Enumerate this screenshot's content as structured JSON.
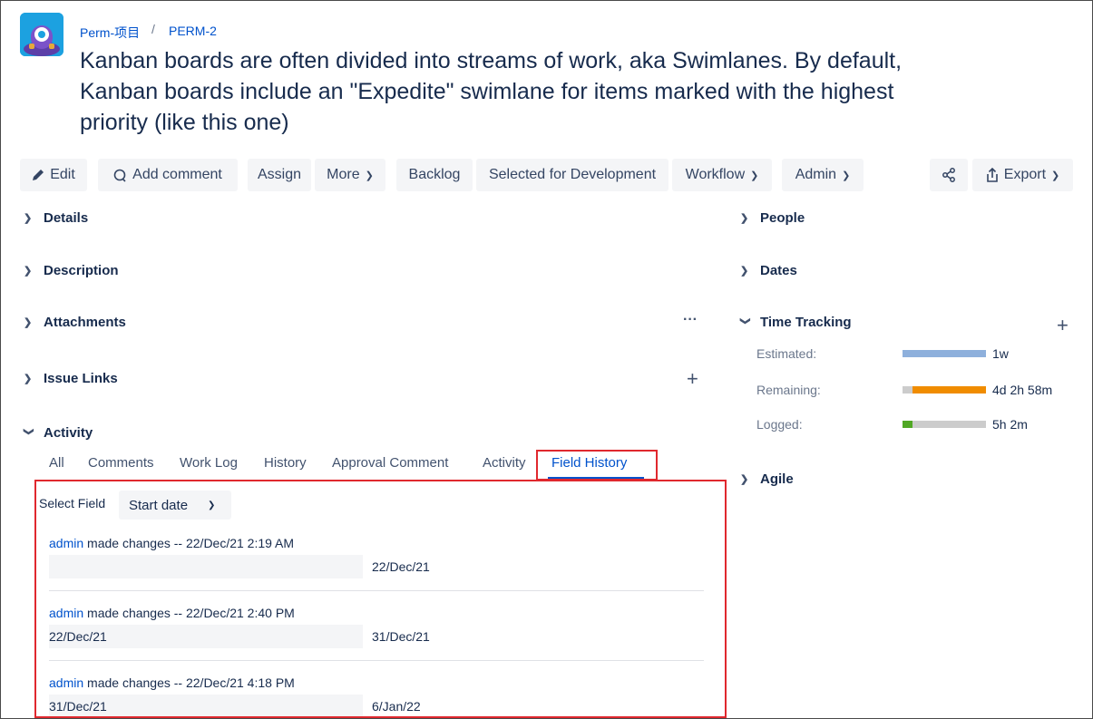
{
  "breadcrumb": {
    "project": "Perm-项目",
    "separator": "/",
    "issue_key": "PERM-2"
  },
  "summary": "Kanban boards are often divided into streams of work, aka Swimlanes. By default, Kanban boards include an \"Expedite\" swimlane for items marked with the highest priority (like this one)",
  "toolbar": {
    "edit": "Edit",
    "add_comment": "Add comment",
    "assign": "Assign",
    "more": "More",
    "backlog": "Backlog",
    "selected_for_development": "Selected for Development",
    "workflow": "Workflow",
    "admin": "Admin",
    "export": "Export"
  },
  "sections": {
    "details": "Details",
    "description": "Description",
    "attachments": "Attachments",
    "attachments_more": "···",
    "issue_links": "Issue Links",
    "activity": "Activity",
    "people": "People",
    "dates": "Dates",
    "time_tracking": "Time Tracking",
    "agile": "Agile"
  },
  "activity_tabs": [
    "All",
    "Comments",
    "Work Log",
    "History",
    "Approval Comment",
    "Activity",
    "Field History"
  ],
  "field_history": {
    "select_label": "Select Field",
    "select_value": "Start date",
    "entries": [
      {
        "user": "admin",
        "text": "made changes -- 22/Dec/21 2:19 AM",
        "old": "",
        "new": "22/Dec/21"
      },
      {
        "user": "admin",
        "text": "made changes -- 22/Dec/21 2:40 PM",
        "old": "22/Dec/21",
        "new": "31/Dec/21"
      },
      {
        "user": "admin",
        "text": "made changes -- 22/Dec/21 4:18 PM",
        "old": "31/Dec/21",
        "new": "6/Jan/22"
      }
    ]
  },
  "time_tracking": {
    "estimated": {
      "label": "Estimated:",
      "value": "1w",
      "fill_fraction": 1.0,
      "color": "#8eb0dc"
    },
    "remaining": {
      "label": "Remaining:",
      "value": "4d 2h 58m",
      "fill_fraction": 0.88,
      "color": "#f08c00"
    },
    "logged": {
      "label": "Logged:",
      "value": "5h 2m",
      "fill_fraction": 0.12,
      "color": "#51a825"
    }
  },
  "colors": {
    "link": "#0052cc",
    "highlight_box": "#e0282e",
    "button_bg": "#f4f5f7"
  }
}
